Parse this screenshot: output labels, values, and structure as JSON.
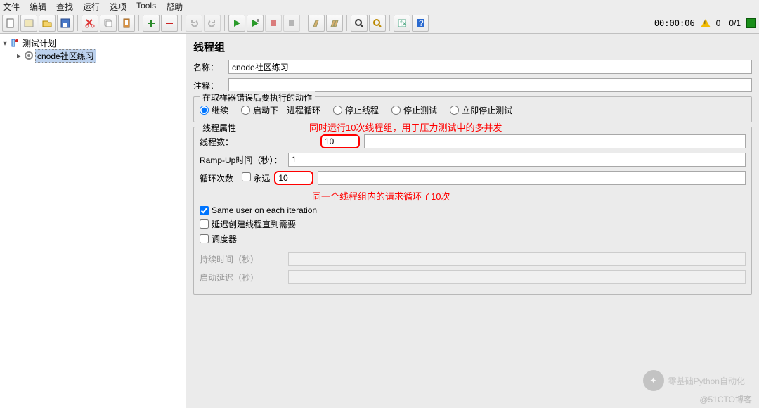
{
  "menu": {
    "file": "文件",
    "edit": "编辑",
    "search": "查找",
    "run": "运行",
    "options": "选项",
    "tools": "Tools",
    "help": "帮助"
  },
  "status": {
    "time": "00:00:06",
    "threads": "0/1",
    "warn": "0"
  },
  "tree": {
    "root": "测试计划",
    "child": "cnode社区练习"
  },
  "panel": {
    "title": "线程组",
    "name_label": "名称：",
    "name_value": "cnode社区练习",
    "comment_label": "注释：",
    "comment_value": "",
    "err_legend": "在取样器错误后要执行的动作",
    "radio1": "继续",
    "radio2": "启动下一进程循环",
    "radio3": "停止线程",
    "radio4": "停止测试",
    "radio5": "立即停止测试",
    "tp_legend": "线程属性",
    "threads_label": "线程数：",
    "threads_value": "10",
    "ramp_label": "Ramp-Up时间（秒）：",
    "ramp_value": "1",
    "loop_label": "循环次数",
    "loop_forever": "永远",
    "loop_value": "10",
    "same_user": "Same user on each iteration",
    "delay_create": "延迟创建线程直到需要",
    "scheduler": "调度器",
    "duration_label": "持续时间（秒）",
    "startup_label": "启动延迟（秒）",
    "anno1": "同时运行10次线程组，用于压力测试中的多并发",
    "anno2": "同一个线程组内的请求循环了10次"
  },
  "watermark": "零基础Python自动化",
  "blogmark": "@51CTO博客"
}
